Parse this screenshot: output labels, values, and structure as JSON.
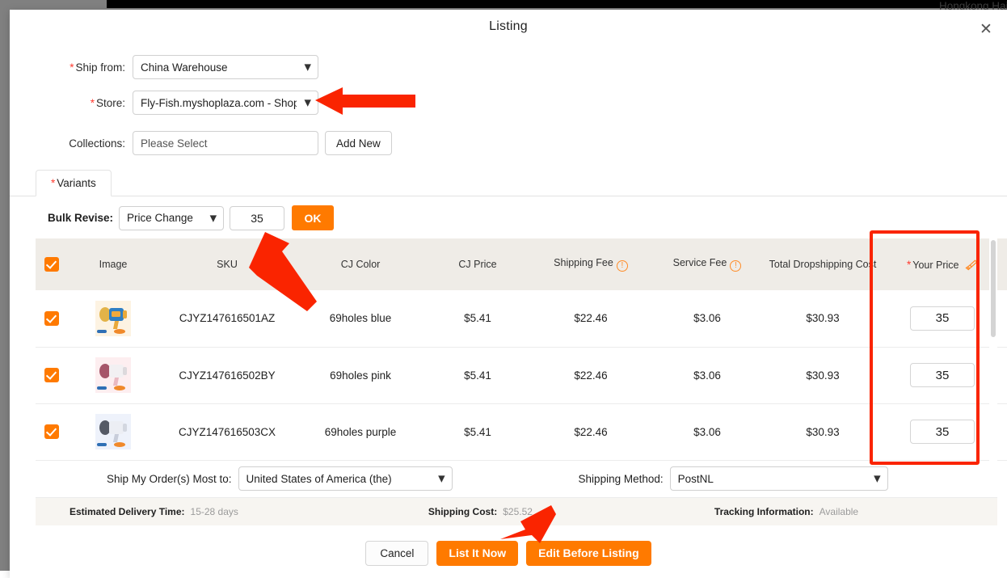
{
  "background": {
    "partner_name": "Hongkong Haihuan Trade Co."
  },
  "modal": {
    "title": "Listing",
    "close_icon": "close-icon"
  },
  "form": {
    "ship_from": {
      "label": "Ship from:",
      "required_mark": "*",
      "value": "China Warehouse",
      "caret_icon": "chevron-down-icon"
    },
    "store": {
      "label": "Store:",
      "required_mark": "*",
      "value": "Fly-Fish.myshoplaza.com - Shoplazza",
      "caret_icon": "chevron-down-icon"
    },
    "collections": {
      "label": "Collections:",
      "placeholder": "Please Select",
      "value": "",
      "add_new_label": "Add New"
    }
  },
  "tabs": [
    {
      "label": "Variants",
      "required_mark": "*",
      "active": true
    }
  ],
  "bulk_revise": {
    "label": "Bulk Revise:",
    "mode": "Price Change",
    "amount": "35",
    "ok_label": "OK",
    "caret_icon": "chevron-down-icon"
  },
  "table": {
    "select_all_checked": true,
    "columns": [
      {
        "key": "checkbox",
        "label": ""
      },
      {
        "key": "image",
        "label": "Image"
      },
      {
        "key": "sku",
        "label": "SKU"
      },
      {
        "key": "color",
        "label": "CJ Color"
      },
      {
        "key": "cj_price",
        "label": "CJ Price"
      },
      {
        "key": "shipping_fee",
        "label": "Shipping Fee",
        "info_icon": "info-circle-icon"
      },
      {
        "key": "service_fee",
        "label": "Service Fee",
        "info_icon": "info-circle-icon"
      },
      {
        "key": "total_cost",
        "label": "Total Dropshipping Cost"
      },
      {
        "key": "your_price",
        "label": "Your Price",
        "required_mark": "*",
        "action_icon": "broom-icon"
      }
    ],
    "rows": [
      {
        "checked": true,
        "image_alt": "bubble-gun-blue",
        "sku": "CJYZ147616501AZ",
        "color": "69holes blue",
        "cj_price": "$5.41",
        "shipping_fee": "$22.46",
        "service_fee": "$3.06",
        "total_cost": "$30.93",
        "your_price": "35"
      },
      {
        "checked": true,
        "image_alt": "bubble-gun-pink",
        "sku": "CJYZ147616502BY",
        "color": "69holes pink",
        "cj_price": "$5.41",
        "shipping_fee": "$22.46",
        "service_fee": "$3.06",
        "total_cost": "$30.93",
        "your_price": "35"
      },
      {
        "checked": true,
        "image_alt": "bubble-gun-purple",
        "sku": "CJYZ147616503CX",
        "color": "69holes purple",
        "cj_price": "$5.41",
        "shipping_fee": "$22.46",
        "service_fee": "$3.06",
        "total_cost": "$30.93",
        "your_price": "35"
      }
    ]
  },
  "shipping": {
    "ship_to_label": "Ship My Order(s) Most to:",
    "ship_to_value": "United States of America (the)",
    "method_label": "Shipping Method:",
    "method_value": "PostNL",
    "caret_icon": "chevron-down-icon"
  },
  "summary": {
    "delivery_time_label": "Estimated Delivery Time:",
    "delivery_time_value": "15-28 days",
    "shipping_cost_label": "Shipping Cost:",
    "shipping_cost_value": "$25.52",
    "tracking_label": "Tracking Information:",
    "tracking_value": "Available"
  },
  "footer": {
    "cancel_label": "Cancel",
    "list_now_label": "List It Now",
    "edit_before_label": "Edit Before Listing"
  },
  "annotations": {
    "color": "#fa2400",
    "arrows": [
      {
        "name": "arrow-to-store-select"
      },
      {
        "name": "arrow-to-bulk-amount"
      },
      {
        "name": "arrow-to-list-it-now"
      }
    ],
    "highlight_boxes": [
      {
        "name": "your-price-column-highlight"
      }
    ]
  }
}
